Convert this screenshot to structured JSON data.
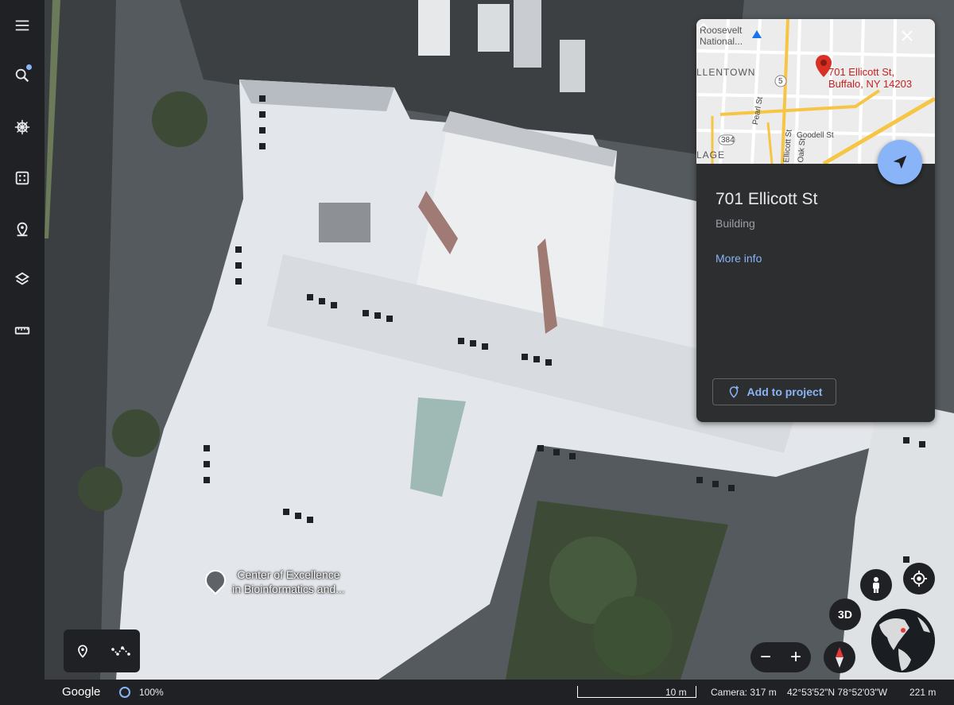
{
  "toolbar": {
    "items": [
      {
        "name": "menu",
        "icon": "menu-icon"
      },
      {
        "name": "search",
        "icon": "search-icon",
        "has_notification": true
      },
      {
        "name": "voyager",
        "icon": "ship-wheel-icon"
      },
      {
        "name": "feeling-lucky",
        "icon": "dice-icon"
      },
      {
        "name": "projects",
        "icon": "map-pin-icon"
      },
      {
        "name": "map-style",
        "icon": "layers-icon"
      },
      {
        "name": "measure",
        "icon": "ruler-icon"
      }
    ]
  },
  "map": {
    "place_label_line1": "Center of Excellence",
    "place_label_line2": "in Bioinformatics and..."
  },
  "card": {
    "minimap": {
      "area_label_top": "Roosevelt",
      "area_label_top2": "National...",
      "district": "LLENTOWN",
      "district2": "LAGE",
      "route_5": "5",
      "route_384": "384",
      "street_pearl": "Pearl St",
      "street_oak": "Oak St",
      "street_ellicott": "Ellicott St",
      "street_goodell": "Goodell St",
      "address_line1": "701 Ellicott St,",
      "address_line2": "Buffalo, NY 14203"
    },
    "title": "701 Ellicott St",
    "subtitle": "Building",
    "more_info": "More info",
    "add_to_project": "Add to project"
  },
  "controls": {
    "three_d_label": "3D",
    "zoom_out": "−",
    "zoom_in": "+"
  },
  "statusbar": {
    "logo": "Google",
    "load_percent": "100%",
    "scale": "10 m",
    "camera": "Camera: 317 m",
    "coordinates": "42°53'52\"N 78°52'03\"W",
    "elevation": "221 m"
  },
  "colors": {
    "toolbar_bg": "#202124",
    "card_bg": "#2d2e30",
    "accent": "#8ab4f8",
    "pin_red": "#c5221f"
  }
}
